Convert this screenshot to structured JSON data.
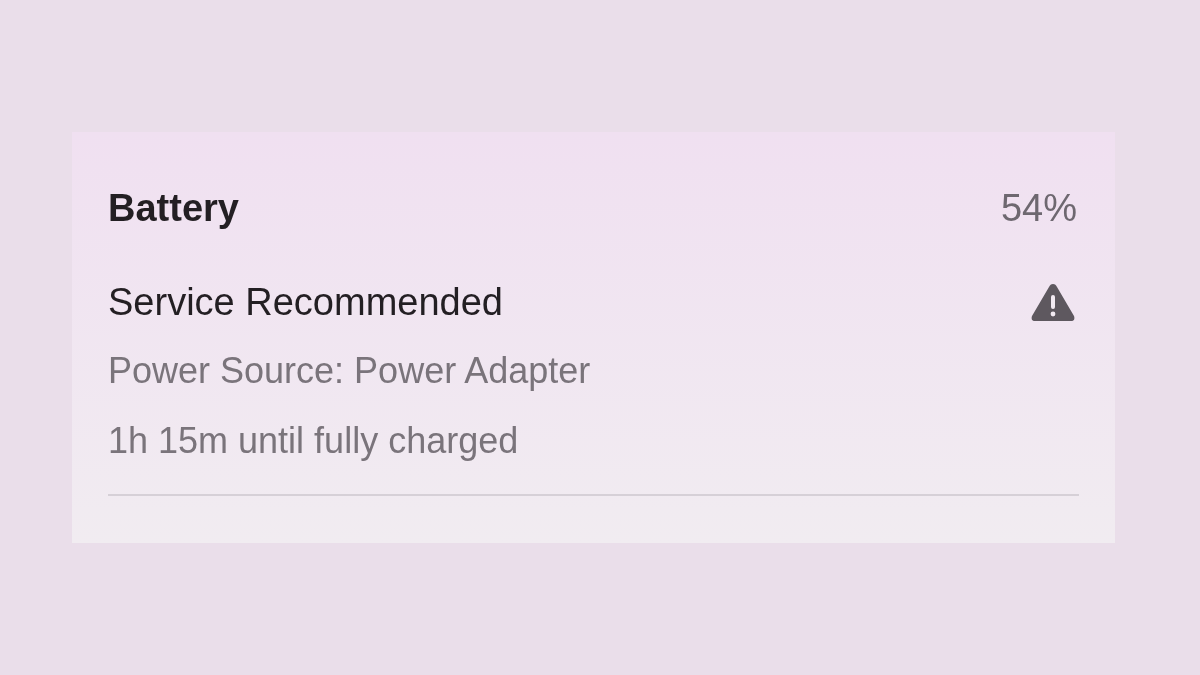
{
  "battery": {
    "title": "Battery",
    "percentage": "54%"
  },
  "condition": {
    "label": "Service Recommended",
    "warning": true
  },
  "details": [
    "Power Source: Power Adapter",
    "1h 15m until fully charged"
  ]
}
